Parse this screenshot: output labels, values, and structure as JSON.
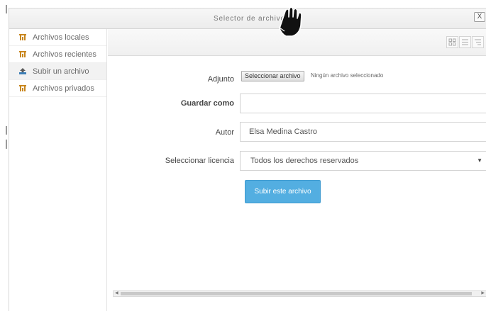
{
  "dialog": {
    "title": "Selector de archivos",
    "close_label": "X"
  },
  "sidebar": {
    "items": [
      {
        "label": "Archivos locales",
        "icon": "repository-icon",
        "active": false
      },
      {
        "label": "Archivos recientes",
        "icon": "repository-icon",
        "active": false
      },
      {
        "label": "Subir un archivo",
        "icon": "upload-icon",
        "active": true
      },
      {
        "label": "Archivos privados",
        "icon": "repository-icon",
        "active": false
      }
    ]
  },
  "toolbar": {
    "view_buttons": [
      "icons-view-icon",
      "list-view-icon",
      "tree-view-icon"
    ]
  },
  "form": {
    "attachment_label": "Adjunto",
    "choose_file_label": "Seleccionar archivo",
    "no_file_text": "Ningún archivo seleccionado",
    "save_as_label": "Guardar como",
    "save_as_value": "",
    "author_label": "Autor",
    "author_value": "Elsa Medina Castro",
    "license_label": "Seleccionar licencia",
    "license_value": "Todos los derechos reservados",
    "upload_button_label": "Subir este archivo"
  },
  "colors": {
    "accent": "#53aee1",
    "repository_icon": "#c8861e",
    "upload_icon": "#3e7fb5"
  }
}
